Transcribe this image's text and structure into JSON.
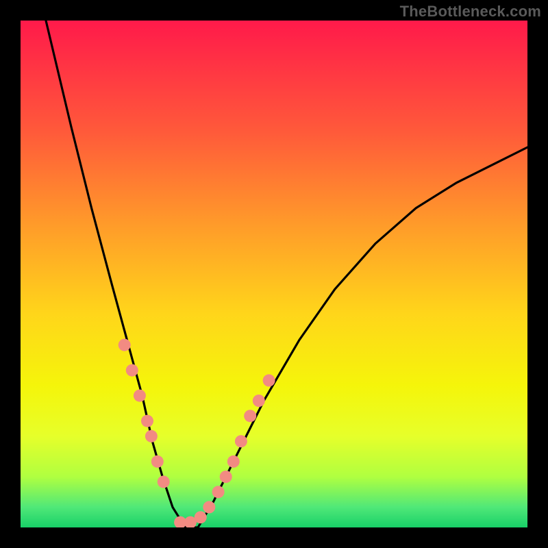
{
  "watermark": "TheBottleneck.com",
  "chart_data": {
    "type": "line",
    "title": "",
    "xlabel": "",
    "ylabel": "",
    "xlim": [
      0,
      100
    ],
    "ylim": [
      0,
      100
    ],
    "grid": false,
    "legend": false,
    "series": [
      {
        "name": "bottleneck-curve",
        "x": [
          5,
          10,
          14,
          18,
          21,
          24,
          26,
          28,
          30,
          32.5,
          35,
          38,
          42,
          48,
          55,
          62,
          70,
          78,
          86,
          94,
          100
        ],
        "y": [
          100,
          79,
          63,
          48,
          37,
          26,
          17,
          10,
          4,
          0,
          0,
          5,
          13,
          25,
          37,
          47,
          56,
          63,
          68,
          72,
          75
        ]
      }
    ],
    "markers": {
      "name": "highlighted-points",
      "color": "#f28b82",
      "x": [
        20.5,
        22,
        23.5,
        25,
        25.8,
        27,
        28.2,
        31.5,
        33.5,
        35.5,
        37.2,
        39,
        40.5,
        42,
        43.5,
        45.3,
        47,
        49
      ],
      "y": [
        36,
        31,
        26,
        21,
        18,
        13,
        9,
        1,
        1,
        2,
        4,
        7,
        10,
        13,
        17,
        22,
        25,
        29
      ]
    },
    "gradient_background": {
      "top": "#ff1a4a",
      "bottom": "#18d068"
    }
  }
}
